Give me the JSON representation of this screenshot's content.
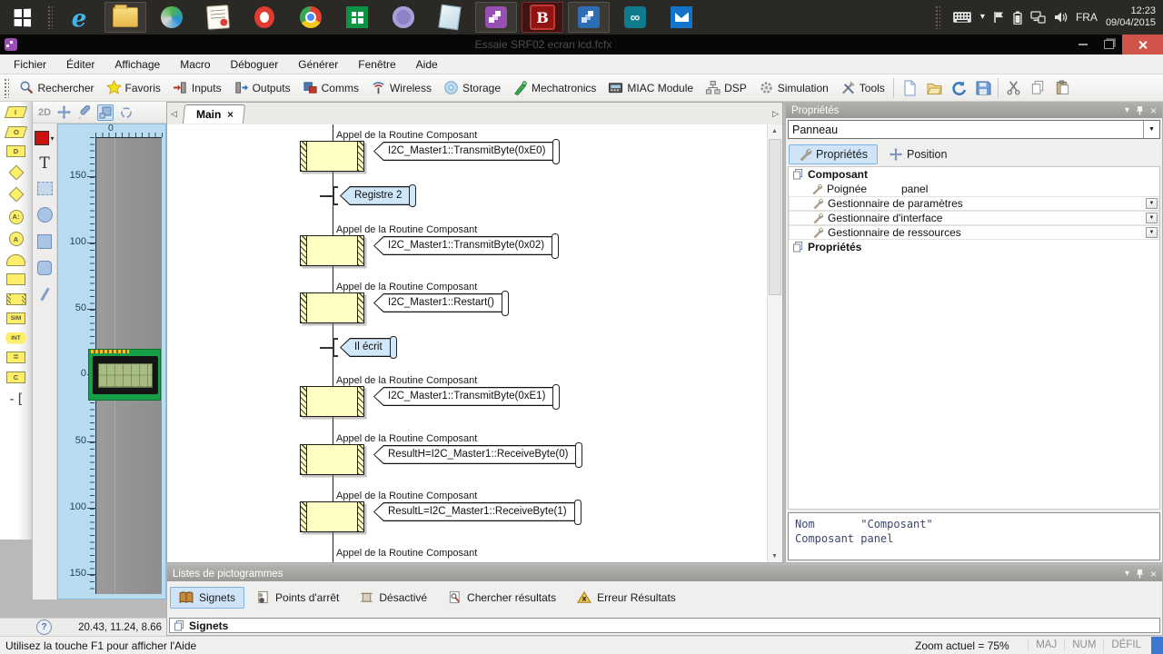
{
  "taskbar": {
    "time": "12:23",
    "date": "09/04/2015",
    "language": "FRA",
    "app_icons": [
      "start",
      "internet-explorer",
      "file-explorer",
      "sync",
      "notes",
      "opera",
      "chrome",
      "windows-store",
      "utorrent",
      "notepad",
      "flowcode-purple",
      "bitdefender",
      "flowcode-blue",
      "arduino",
      "mail"
    ],
    "tray_icons": [
      "keyboard",
      "caret-down",
      "flag",
      "battery",
      "network",
      "volume"
    ]
  },
  "window": {
    "title": "Essaie SRF02 ecran lcd.fcfx"
  },
  "menubar": {
    "items": [
      "Fichier",
      "Éditer",
      "Affichage",
      "Macro",
      "Déboguer",
      "Générer",
      "Fenêtre",
      "Aide"
    ]
  },
  "toolbar": {
    "buttons": [
      "Rechercher",
      "Favoris",
      "Inputs",
      "Outputs",
      "Comms",
      "Wireless",
      "Storage",
      "Mechatronics",
      "MIAC Module",
      "DSP",
      "Simulation",
      "Tools"
    ],
    "file_icons": [
      "new-document",
      "open-folder",
      "refresh",
      "save",
      "cut",
      "copy",
      "paste"
    ]
  },
  "glyphs": {
    "caret_down": "▾",
    "close_x": "×",
    "nav_left": "◁",
    "nav_right": "▷",
    "scroll_up": "▲",
    "scroll_down": "▼",
    "combo_arrow": "▼",
    "help": "?",
    "bracket": "-[",
    "infinity": "∞",
    "letter_b": "B",
    "letter_e": "e"
  },
  "strip": {
    "icons": [
      {
        "name": "input",
        "glyph": "I"
      },
      {
        "name": "output",
        "glyph": "O"
      },
      {
        "name": "delay",
        "glyph": "D"
      },
      {
        "name": "decision",
        "glyph": ""
      },
      {
        "name": "switch",
        "glyph": ""
      },
      {
        "name": "connection-point",
        "glyph": "A:"
      },
      {
        "name": "goto-connection",
        "glyph": "A"
      },
      {
        "name": "macro",
        "glyph": ""
      },
      {
        "name": "macro-box",
        "glyph": ""
      },
      {
        "name": "component-macro",
        "glyph": ""
      },
      {
        "name": "simulation",
        "glyph": "SIM"
      },
      {
        "name": "interrupt",
        "glyph": "INT"
      },
      {
        "name": "calculation",
        "glyph": "="
      },
      {
        "name": "c-code",
        "glyph": "C"
      },
      {
        "name": "comment",
        "glyph": ""
      }
    ]
  },
  "panel2d": {
    "label": "2D",
    "text_tool": "T",
    "hruler_zero": "0",
    "vruler": [
      "150",
      "100",
      "50",
      "0",
      "50",
      "100",
      "150"
    ],
    "coords": "20.43, 11.24, 8.66"
  },
  "editor": {
    "tab": "Main",
    "steps": [
      {
        "kind": "component",
        "caption": "Appel de la Routine Composant",
        "label": "I2C_Master1::TransmitByte(0xE0)"
      },
      {
        "kind": "comment",
        "label": "Registre 2"
      },
      {
        "kind": "component",
        "caption": "Appel de la Routine Composant",
        "label": "I2C_Master1::TransmitByte(0x02)"
      },
      {
        "kind": "component",
        "caption": "Appel de la Routine Composant",
        "label": "I2C_Master1::Restart()"
      },
      {
        "kind": "comment",
        "label": "Il écrit"
      },
      {
        "kind": "component",
        "caption": "Appel de la Routine Composant",
        "label": "I2C_Master1::TransmitByte(0xE1)"
      },
      {
        "kind": "component",
        "caption": "Appel de la Routine Composant",
        "label": "ResultH=I2C_Master1::ReceiveByte(0)"
      },
      {
        "kind": "component",
        "caption": "Appel de la Routine Composant",
        "label": "ResultL=I2C_Master1::ReceiveByte(1)"
      },
      {
        "kind": "partial",
        "caption": "Appel de la Routine Composant"
      }
    ]
  },
  "props": {
    "title": "Propriétés",
    "selector_value": "Panneau",
    "tabs": [
      {
        "label": "Propriétés"
      },
      {
        "label": "Position"
      }
    ],
    "tree": {
      "group1": "Composant",
      "rows": [
        {
          "label": "Poignée",
          "value": "panel"
        },
        {
          "label": "Gestionnaire de paramètres"
        },
        {
          "label": "Gestionnaire d'interface"
        },
        {
          "label": "Gestionnaire de ressources"
        }
      ],
      "group2": "Propriétés"
    },
    "info": {
      "line1": "Nom       \"Composant\"",
      "line2": "Composant panel"
    }
  },
  "picto": {
    "title": "Listes de pictogrammes",
    "tabs": [
      "Signets",
      "Points d'arrêt",
      "Désactivé",
      "Chercher résultats",
      "Erreur Résultats"
    ],
    "active_tab": "Signets",
    "list_header": "Signets"
  },
  "status": {
    "help": "Utilisez la touche F1 pour afficher l'Aide",
    "zoom": "Zoom actuel = 75%",
    "keys": [
      "MAJ",
      "NUM",
      "DÉFIL"
    ]
  }
}
